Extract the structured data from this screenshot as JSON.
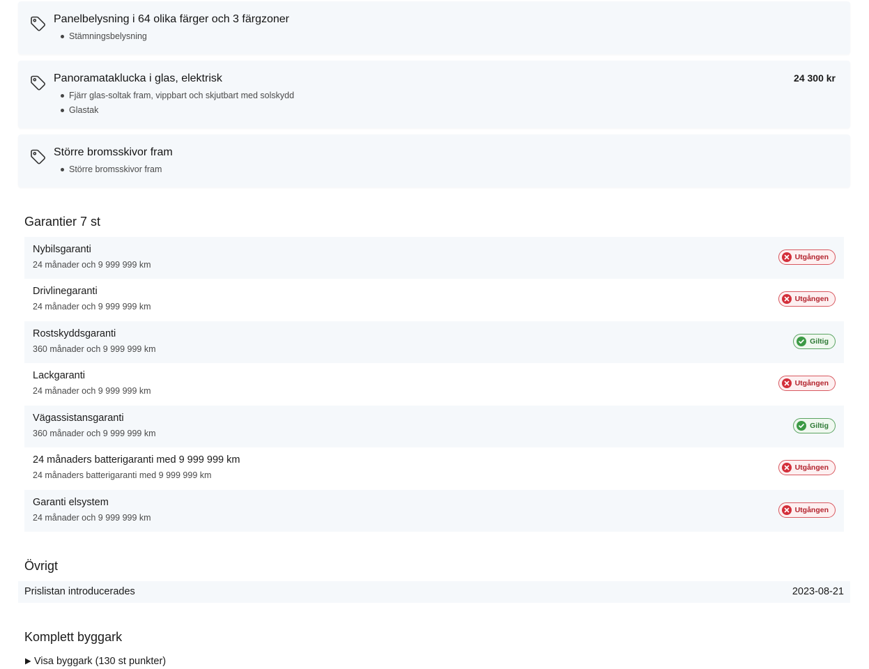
{
  "options": [
    {
      "title": "Panelbelysning i 64 olika färger och 3 färgzoner",
      "price": "",
      "bullets": [
        "Stämningsbelysning"
      ],
      "icon": "price-tag-icon"
    },
    {
      "title": "Panoramataklucka i glas, elektrisk",
      "price": "24 300 kr",
      "bullets": [
        "Fjärr glas-soltak fram, vippbart och skjutbart med solskydd",
        "Glastak"
      ],
      "icon": "price-tag-icon"
    },
    {
      "title": "Större bromsskivor fram",
      "price": "",
      "bullets": [
        "Större bromsskivor fram"
      ],
      "icon": "price-tag-icon"
    }
  ],
  "warranties": {
    "heading": "Garantier 7 st",
    "items": [
      {
        "name": "Nybilsgaranti",
        "detail": "24 månader och 9 999 999 km",
        "status": "Utgången"
      },
      {
        "name": "Drivlinegaranti",
        "detail": "24 månader och 9 999 999 km",
        "status": "Utgången"
      },
      {
        "name": "Rostskyddsgaranti",
        "detail": "360 månader och 9 999 999 km",
        "status": "Giltig"
      },
      {
        "name": "Lackgaranti",
        "detail": "24 månader och 9 999 999 km",
        "status": "Utgången"
      },
      {
        "name": "Vägassistansgaranti",
        "detail": "360 månader och 9 999 999 km",
        "status": "Giltig"
      },
      {
        "name": "24 månaders batterigaranti med 9 999 999 km",
        "detail": "24 månaders batterigaranti med 9 999 999 km",
        "status": "Utgången"
      },
      {
        "name": "Garanti elsystem",
        "detail": "24 månader och 9 999 999 km",
        "status": "Utgången"
      }
    ]
  },
  "misc": {
    "heading": "Övrigt",
    "label": "Prislistan introducerades",
    "value": "2023-08-21"
  },
  "build": {
    "heading": "Komplett byggark",
    "toggle_label": "Visa byggark (130 st punkter)"
  },
  "colors": {
    "card_bg": "#f5f8fb",
    "expired_red": "#d32f3a",
    "valid_green": "#3c9a45",
    "text": "#1a1a1a"
  }
}
